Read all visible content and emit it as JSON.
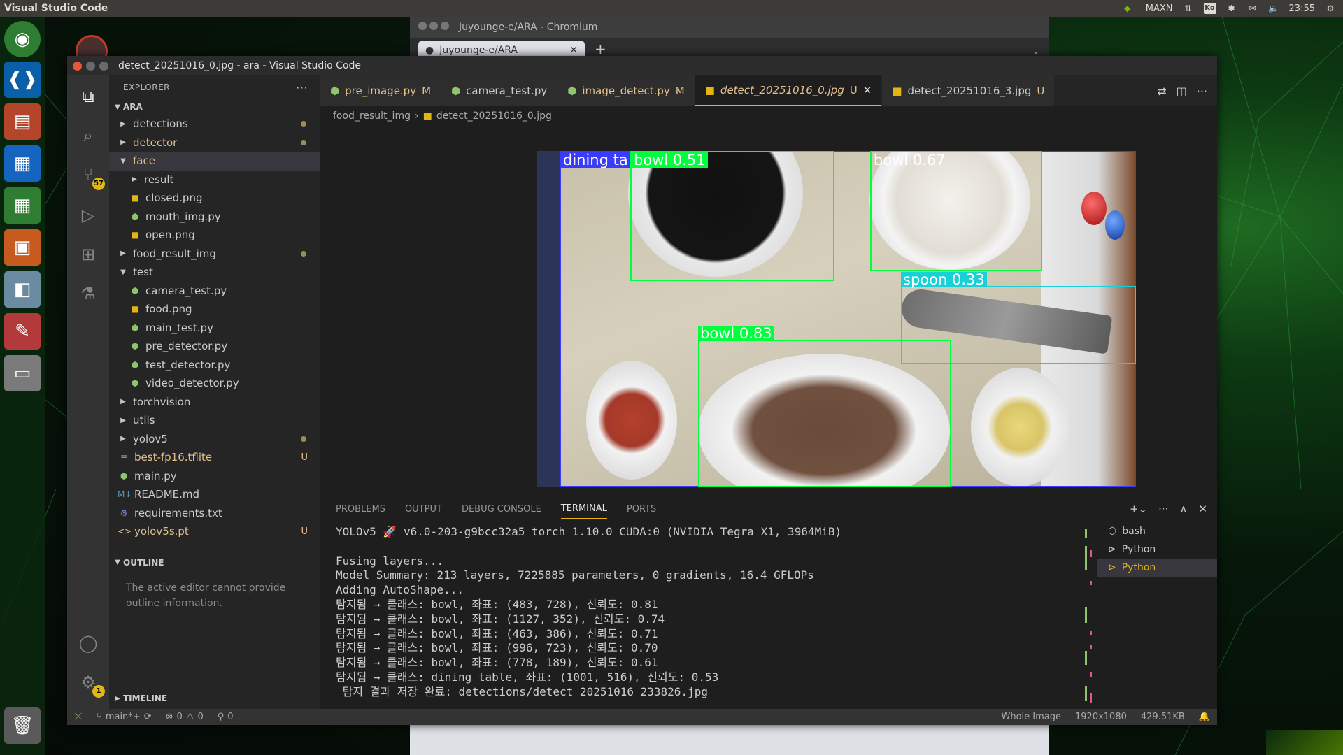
{
  "topbar": {
    "app_name": "Visual Studio Code",
    "power_mode": "MAXN",
    "ime": "Ko",
    "clock": "23:55"
  },
  "chromium": {
    "title": "Juyounge-e/ARA - Chromium",
    "tab_label": "Juyounge-e/ARA"
  },
  "vscode": {
    "title": "detect_20251016_0.jpg - ara - Visual Studio Code",
    "explorer": {
      "header": "EXPLORER",
      "root": "ARA",
      "items": [
        {
          "label": "detections",
          "kind": "folder",
          "depth": 0,
          "open": false,
          "mark": "dot"
        },
        {
          "label": "detector",
          "kind": "folder",
          "depth": 0,
          "open": false,
          "mark": "dot",
          "modified": true
        },
        {
          "label": "face",
          "kind": "folder",
          "depth": 0,
          "open": true,
          "mark": "",
          "modified": true,
          "selected": true
        },
        {
          "label": "result",
          "kind": "folder",
          "depth": 1,
          "open": false,
          "mark": ""
        },
        {
          "label": "closed.png",
          "kind": "png",
          "depth": 1,
          "mark": ""
        },
        {
          "label": "mouth_img.py",
          "kind": "py",
          "depth": 1,
          "mark": ""
        },
        {
          "label": "open.png",
          "kind": "png",
          "depth": 1,
          "mark": ""
        },
        {
          "label": "food_result_img",
          "kind": "folder",
          "depth": 0,
          "open": false,
          "mark": "dot"
        },
        {
          "label": "test",
          "kind": "folder",
          "depth": 0,
          "open": true,
          "mark": ""
        },
        {
          "label": "camera_test.py",
          "kind": "py",
          "depth": 1,
          "mark": ""
        },
        {
          "label": "food.png",
          "kind": "png",
          "depth": 1,
          "mark": ""
        },
        {
          "label": "main_test.py",
          "kind": "py",
          "depth": 1,
          "mark": ""
        },
        {
          "label": "pre_detector.py",
          "kind": "py",
          "depth": 1,
          "mark": ""
        },
        {
          "label": "test_detector.py",
          "kind": "py",
          "depth": 1,
          "mark": ""
        },
        {
          "label": "video_detector.py",
          "kind": "py",
          "depth": 1,
          "mark": ""
        },
        {
          "label": "torchvision",
          "kind": "folder",
          "depth": 0,
          "open": false,
          "mark": ""
        },
        {
          "label": "utils",
          "kind": "folder",
          "depth": 0,
          "open": false,
          "mark": ""
        },
        {
          "label": "yolov5",
          "kind": "folder",
          "depth": 0,
          "open": false,
          "mark": "dot"
        },
        {
          "label": "best-fp16.tflite",
          "kind": "tflite",
          "depth": -1,
          "mark": "U",
          "modified": true
        },
        {
          "label": "main.py",
          "kind": "py",
          "depth": -1,
          "mark": ""
        },
        {
          "label": "README.md",
          "kind": "md",
          "depth": -1,
          "mark": ""
        },
        {
          "label": "requirements.txt",
          "kind": "txt",
          "depth": -1,
          "mark": ""
        },
        {
          "label": "yolov5s.pt",
          "kind": "pt",
          "depth": -1,
          "mark": "U",
          "modified": true
        }
      ],
      "outline_header": "OUTLINE",
      "outline_message": "The active editor cannot provide outline information.",
      "timeline_header": "TIMELINE"
    },
    "activity": {
      "scm_badge": "57",
      "settings_badge": "1"
    },
    "tabs": [
      {
        "label": "pre_image.py",
        "mark": "M",
        "kind": "py",
        "active": false
      },
      {
        "label": "camera_test.py",
        "mark": "",
        "kind": "py",
        "active": false
      },
      {
        "label": "image_detect.py",
        "mark": "M",
        "kind": "py",
        "active": false,
        "modified": true
      },
      {
        "label": "detect_20251016_0.jpg",
        "mark": "U",
        "kind": "img",
        "active": true
      },
      {
        "label": "detect_20251016_3.jpg",
        "mark": "U",
        "kind": "img",
        "active": false
      }
    ],
    "breadcrumb": {
      "folder": "food_result_img",
      "file": "detect_20251016_0.jpg"
    },
    "detections": [
      {
        "label": "dining ta",
        "color": "#3b3bff"
      },
      {
        "label": "bowl 0.51",
        "color": "#00ff3c"
      },
      {
        "label": "bowl 0.67",
        "color": "#00ff3c"
      },
      {
        "label": "spoon 0.33",
        "color": "#19d0d6"
      },
      {
        "label": "bowl 0.83",
        "color": "#00ff3c"
      }
    ],
    "panel": {
      "tabs": [
        "PROBLEMS",
        "OUTPUT",
        "DEBUG CONSOLE",
        "TERMINAL",
        "PORTS"
      ],
      "active_tab": "TERMINAL",
      "terminal_lines": [
        "YOLOv5 🚀 v6.0-203-g9bcc32a5 torch 1.10.0 CUDA:0 (NVIDIA Tegra X1, 3964MiB)",
        "",
        "Fusing layers...",
        "Model Summary: 213 layers, 7225885 parameters, 0 gradients, 16.4 GFLOPs",
        "Adding AutoShape...",
        "탐지됨 → 클래스: bowl, 좌표: (483, 728), 신뢰도: 0.81",
        "탐지됨 → 클래스: bowl, 좌표: (1127, 352), 신뢰도: 0.74",
        "탐지됨 → 클래스: bowl, 좌표: (463, 386), 신뢰도: 0.71",
        "탐지됨 → 클래스: bowl, 좌표: (996, 723), 신뢰도: 0.70",
        "탐지됨 → 클래스: bowl, 좌표: (778, 189), 신뢰도: 0.61",
        "탐지됨 → 클래스: dining table, 좌표: (1001, 516), 신뢰도: 0.53",
        " 탐지 결과 저장 완료: detections/detect_20251016_233826.jpg"
      ],
      "terminals": [
        {
          "label": "bash",
          "active": false
        },
        {
          "label": "Python",
          "active": false
        },
        {
          "label": "Python",
          "active": true
        }
      ]
    },
    "status": {
      "branch": "main*+",
      "errors": "0",
      "warnings": "0",
      "ports": "0",
      "view": "Whole Image",
      "dimensions": "1920x1080",
      "size": "429.51KB"
    }
  },
  "colors": {
    "accent": "#e2b714",
    "python": "#8fc46a",
    "modified": "#e2c08d"
  }
}
